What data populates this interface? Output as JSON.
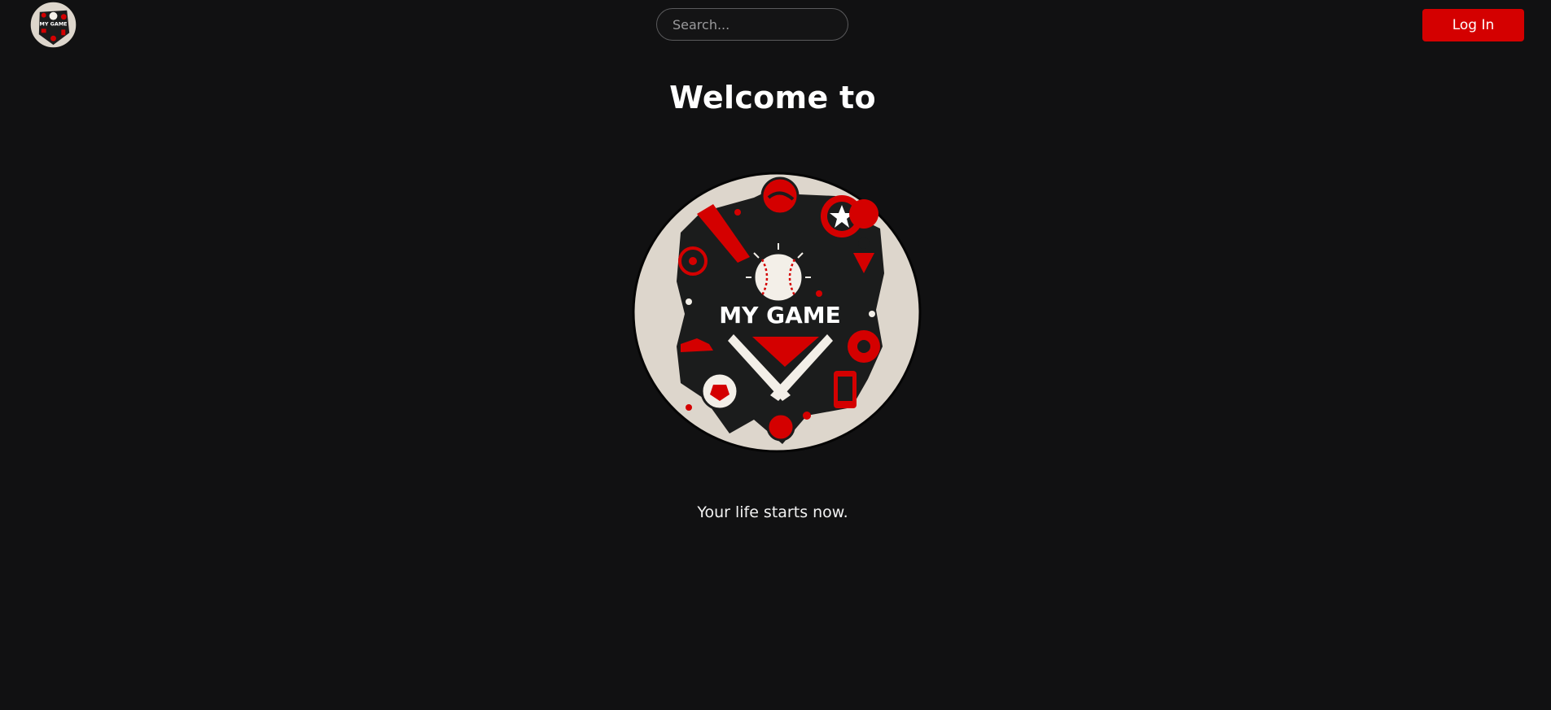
{
  "header": {
    "logo_name": "my-game-logo",
    "search": {
      "placeholder": "Search...",
      "value": ""
    },
    "login_label": "Log In"
  },
  "hero": {
    "title": "Welcome to",
    "logo_text": "MY GAME",
    "tagline": "Your life starts now."
  },
  "colors": {
    "background": "#111112",
    "accent": "#d40000",
    "logo_cream": "#ddd6cc",
    "logo_dark": "#1b1c1c"
  }
}
